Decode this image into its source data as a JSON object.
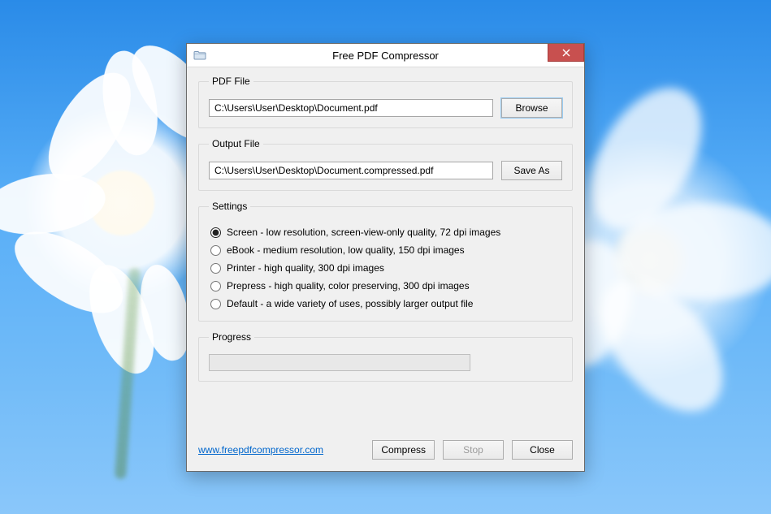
{
  "window": {
    "title": "Free PDF Compressor",
    "close_icon": "close-icon"
  },
  "pdf_file": {
    "legend": "PDF File",
    "value": "C:\\Users\\User\\Desktop\\Document.pdf",
    "browse_label": "Browse"
  },
  "output_file": {
    "legend": "Output File",
    "value": "C:\\Users\\User\\Desktop\\Document.compressed.pdf",
    "saveas_label": "Save As"
  },
  "settings": {
    "legend": "Settings",
    "options": [
      {
        "label": "Screen - low resolution, screen-view-only quality, 72 dpi images",
        "selected": true
      },
      {
        "label": "eBook - medium resolution, low quality, 150 dpi images",
        "selected": false
      },
      {
        "label": "Printer - high quality, 300 dpi images",
        "selected": false
      },
      {
        "label": "Prepress - high quality, color preserving, 300 dpi images",
        "selected": false
      },
      {
        "label": "Default - a wide variety of uses, possibly larger output file",
        "selected": false
      }
    ]
  },
  "progress": {
    "legend": "Progress",
    "value": 0
  },
  "footer": {
    "link_text": "www.freepdfcompressor.com",
    "compress_label": "Compress",
    "stop_label": "Stop",
    "close_label": "Close",
    "stop_enabled": false
  }
}
